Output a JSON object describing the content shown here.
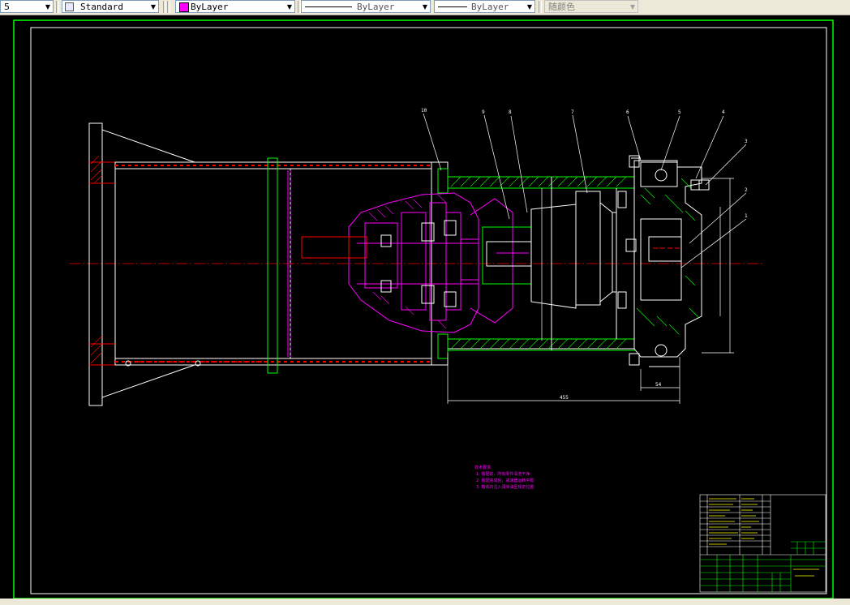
{
  "toolbar": {
    "first_combo_value": "5",
    "text_style": {
      "value": "Standard"
    },
    "layer": {
      "value": "ByLayer",
      "swatch_color": "#ff00ff"
    },
    "linetype": {
      "value": "ByLayer"
    },
    "lineweight": {
      "value": "ByLayer"
    },
    "plotstyle": {
      "value": "随颜色"
    }
  },
  "drawing": {
    "colors": {
      "background": "#000000",
      "border": "#ffffff",
      "outer_frame": "#00ff00",
      "magenta": "#ff00ff",
      "green": "#00ff00",
      "red": "#ff0000",
      "yellow": "#ffff00",
      "white": "#ffffff"
    },
    "balloons": [
      "10",
      "9",
      "8",
      "7",
      "6",
      "5",
      "4",
      "3",
      "2",
      "1"
    ],
    "dimensions": {
      "total_length": "455",
      "right_offset": "54"
    },
    "tech_notes": [
      "技术要求",
      "1. 装配前，所有零件清洗干净",
      "2. 装配完成后，减速器运转平稳",
      "3. 箱体内注入润滑油至规定位置"
    ]
  }
}
